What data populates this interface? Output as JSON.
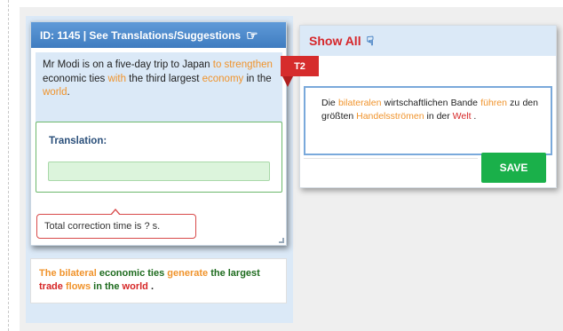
{
  "left_panel": {
    "header_title": "ID: 1145 | See Translations/Suggestions",
    "header_icon": "hand-pointer-icon",
    "source_tokens": [
      {
        "text": "Mr Modi is on a five-day trip to Japan ",
        "color": "#222222"
      },
      {
        "text": "to strengthen",
        "color": "#f0932b"
      },
      {
        "text": " economic ties ",
        "color": "#222222"
      },
      {
        "text": "with",
        "color": "#f0932b"
      },
      {
        "text": " the third largest ",
        "color": "#222222"
      },
      {
        "text": "economy",
        "color": "#f0932b"
      },
      {
        "text": " in the ",
        "color": "#222222"
      },
      {
        "text": "world",
        "color": "#f0932b"
      },
      {
        "text": ".",
        "color": "#222222"
      }
    ],
    "translation_label": "Translation:",
    "translation_value": "",
    "time_tip": "Total correction time is ? s."
  },
  "badge": {
    "label": "T2",
    "color": "#d62c2c"
  },
  "reference_tokens": [
    {
      "text": "The bilateral",
      "color": "#f0932b"
    },
    {
      "text": " economic ties ",
      "color": "#1e6b1e"
    },
    {
      "text": "generate",
      "color": "#f0932b"
    },
    {
      "text": " the largest ",
      "color": "#1e6b1e"
    },
    {
      "text": "trade",
      "color": "#d62626"
    },
    {
      "text": " ",
      "color": "#222222"
    },
    {
      "text": "flows",
      "color": "#f0932b"
    },
    {
      "text": " in the ",
      "color": "#1e6b1e"
    },
    {
      "text": "world",
      "color": "#d62626"
    },
    {
      "text": " .",
      "color": "#222222"
    }
  ],
  "right_panel": {
    "header_title": "Show All",
    "header_icon": "hand-down-icon",
    "target_tokens": [
      {
        "text": "Die ",
        "color": "#222222"
      },
      {
        "text": "bilateralen",
        "color": "#f0932b"
      },
      {
        "text": " wirtschaftlichen Bande ",
        "color": "#222222"
      },
      {
        "text": "führen",
        "color": "#f0932b"
      },
      {
        "text": " zu den größten ",
        "color": "#222222"
      },
      {
        "text": "Handelsströmen",
        "color": "#f0932b"
      },
      {
        "text": " in der ",
        "color": "#222222"
      },
      {
        "text": "Welt",
        "color": "#d62626"
      },
      {
        "text": " .",
        "color": "#222222"
      }
    ],
    "save_label": "SAVE"
  },
  "colors": {
    "header_blue": "#3f7cc0",
    "panel_blue": "#dbe9f7",
    "save_green": "#1ab04a",
    "accent_red": "#d62c2c"
  }
}
